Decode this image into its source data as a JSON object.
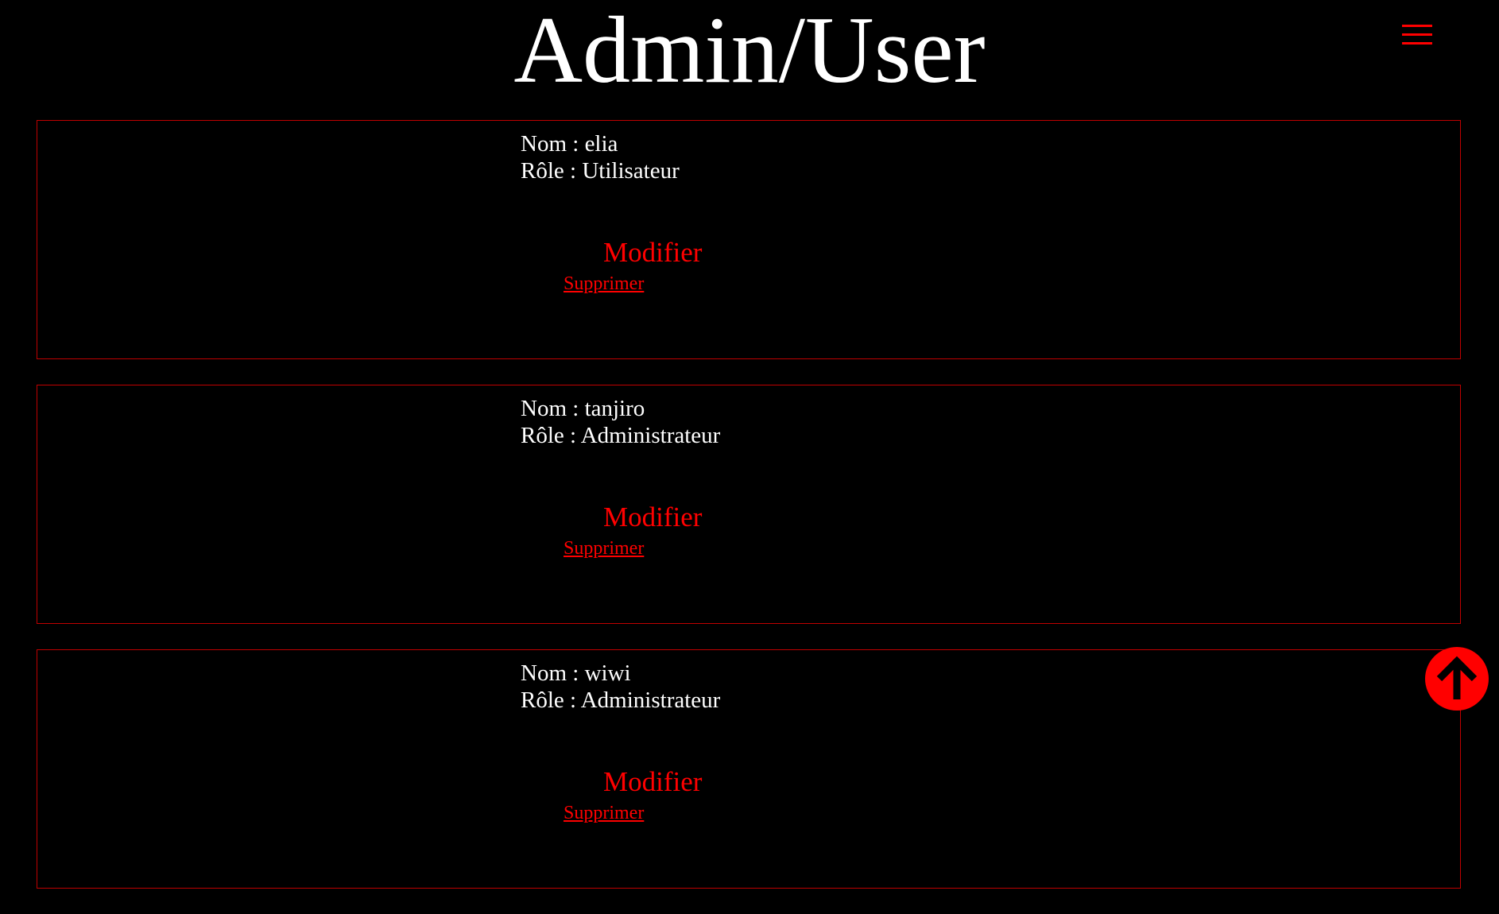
{
  "header": {
    "title": "Admin/User",
    "menu_icon": "hamburger-menu-icon"
  },
  "users": [
    {
      "name_prefix": "Nom : ",
      "name": "elia",
      "role_prefix": "Rôle : ",
      "role": "Utilisateur",
      "modify_label": "Modifier",
      "delete_label": "Supprimer"
    },
    {
      "name_prefix": "Nom : ",
      "name": "tanjiro",
      "role_prefix": "Rôle : ",
      "role": "Administrateur",
      "modify_label": "Modifier",
      "delete_label": "Supprimer"
    },
    {
      "name_prefix": "Nom : ",
      "name": "wiwi",
      "role_prefix": "Rôle : ",
      "role": "Administrateur",
      "modify_label": "Modifier",
      "delete_label": "Supprimer"
    }
  ],
  "scroll_top": {
    "icon": "arrow-up-icon"
  },
  "colors": {
    "background": "#000000",
    "text": "#ffffff",
    "accent": "#ff0000",
    "border": "#c00000"
  }
}
